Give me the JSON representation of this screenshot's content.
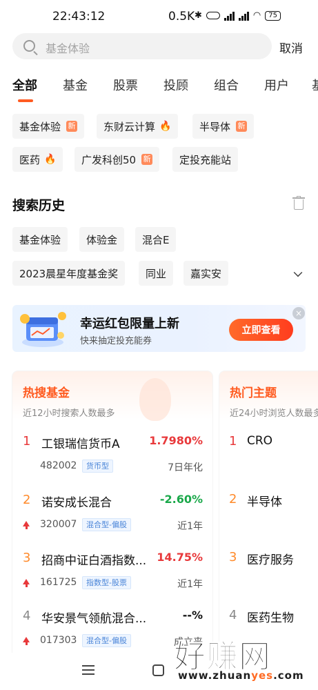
{
  "status_bar": {
    "time": "22:43:12",
    "speed": "0.5K",
    "battery": "75"
  },
  "search": {
    "placeholder": "基金体验",
    "cancel_label": "取消"
  },
  "tabs": [
    "全部",
    "基金",
    "股票",
    "投顾",
    "组合",
    "用户",
    "基"
  ],
  "hot_searches": [
    {
      "label": "基金体验",
      "badge": "新"
    },
    {
      "label": "东财云计算",
      "badge": "fire"
    },
    {
      "label": "半导体",
      "badge": "新"
    },
    {
      "label": "医药",
      "badge": "fire"
    },
    {
      "label": "广发科创50",
      "badge": "新"
    },
    {
      "label": "定投充能站",
      "badge": ""
    }
  ],
  "history": {
    "title": "搜索历史",
    "items": [
      "基金体验",
      "体验金",
      "混合E",
      "2023晨星年度基金奖",
      "同业",
      "嘉实安"
    ]
  },
  "banner": {
    "title": "幸运红包限量上新",
    "subtitle": "快来抽定投充能券",
    "button_label": "立即查看"
  },
  "hot_funds": {
    "title": "热搜基金",
    "subtitle": "近12小时搜索人数最多",
    "items": [
      {
        "rank": "1",
        "name": "工银瑞信货币A",
        "return": "1.7980%",
        "code": "482002",
        "tag": "货币型",
        "period": "7日年化",
        "trend": ""
      },
      {
        "rank": "2",
        "name": "诺安成长混合",
        "return": "-2.60%",
        "code": "320007",
        "tag": "混合型-偏股",
        "period": "近1年",
        "trend": "up"
      },
      {
        "rank": "3",
        "name": "招商中证白酒指数...",
        "return": "14.75%",
        "code": "161725",
        "tag": "指数型-股票",
        "period": "近1年",
        "trend": "up"
      },
      {
        "rank": "4",
        "name": "华安景气领航混合...",
        "return": "--%",
        "code": "017303",
        "tag": "混合型-偏股",
        "period": "成立来",
        "trend": "up"
      }
    ]
  },
  "hot_topics": {
    "title": "热门主题",
    "subtitle": "近24小时浏览人数最多",
    "items": [
      {
        "rank": "1",
        "name": "CRO"
      },
      {
        "rank": "2",
        "name": "半导体"
      },
      {
        "rank": "3",
        "name": "医疗服务"
      },
      {
        "rank": "4",
        "name": "医药生物"
      }
    ]
  },
  "watermark": {
    "big": "好赚网",
    "small_prefix": "www.zhuan",
    "small_accent": "yes",
    "small_suffix": ".com"
  },
  "colors": {
    "accent": "#ff5b22",
    "rise": "#e8393b",
    "fall": "#1aa84a",
    "rank_top": "#e8393b",
    "rank_mid": "#ff8a2a",
    "rank_low": "#888888"
  }
}
